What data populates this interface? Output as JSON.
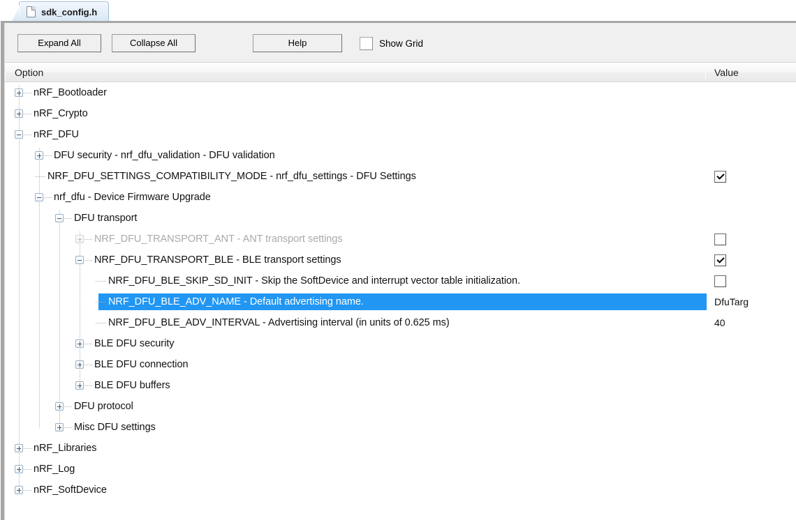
{
  "window": {
    "tab": {
      "label": "sdk_config.h",
      "icon": "document-icon"
    }
  },
  "toolbar": {
    "expand_all": "Expand All",
    "collapse_all": "Collapse All",
    "help": "Help",
    "show_grid_label": "Show Grid",
    "show_grid_checked": false
  },
  "columns": {
    "option": "Option",
    "value": "Value"
  },
  "colors": {
    "selection": "#2196f3",
    "selection_text": "#ffffff",
    "disabled_text": "#aaaaaa",
    "toolbar_bg": "#f0f0f0",
    "frame_border": "#a6a6a6"
  },
  "tree": {
    "rows": [
      {
        "label": "nRF_Bootloader",
        "depth": 0,
        "expander": "plus",
        "value_type": "none",
        "value": "",
        "state": "normal",
        "selected": false
      },
      {
        "label": "nRF_Crypto",
        "depth": 0,
        "expander": "plus",
        "value_type": "none",
        "value": "",
        "state": "normal",
        "selected": false
      },
      {
        "label": "nRF_DFU",
        "depth": 0,
        "expander": "minus",
        "value_type": "none",
        "value": "",
        "state": "normal",
        "selected": false
      },
      {
        "label": "DFU security - nrf_dfu_validation - DFU validation",
        "depth": 1,
        "expander": "plus",
        "value_type": "none",
        "value": "",
        "state": "normal",
        "selected": false
      },
      {
        "label": "NRF_DFU_SETTINGS_COMPATIBILITY_MODE  - nrf_dfu_settings - DFU Settings",
        "depth": 1,
        "expander": "none",
        "value_type": "checkbox",
        "value": "checked",
        "state": "normal",
        "selected": false
      },
      {
        "label": "nrf_dfu - Device Firmware Upgrade",
        "depth": 1,
        "expander": "minus",
        "value_type": "none",
        "value": "",
        "state": "normal",
        "selected": false
      },
      {
        "label": "DFU transport",
        "depth": 2,
        "expander": "minus",
        "value_type": "none",
        "value": "",
        "state": "normal",
        "selected": false
      },
      {
        "label": "NRF_DFU_TRANSPORT_ANT - ANT transport settings",
        "depth": 3,
        "expander": "plus",
        "value_type": "checkbox",
        "value": "unchecked",
        "state": "disabled",
        "selected": false
      },
      {
        "label": "NRF_DFU_TRANSPORT_BLE - BLE transport settings",
        "depth": 3,
        "expander": "minus",
        "value_type": "checkbox",
        "value": "checked",
        "state": "normal",
        "selected": false
      },
      {
        "label": "NRF_DFU_BLE_SKIP_SD_INIT  - Skip the SoftDevice and interrupt vector table initialization.",
        "depth": 4,
        "expander": "none",
        "value_type": "checkbox",
        "value": "unchecked",
        "state": "normal",
        "selected": false
      },
      {
        "label": "NRF_DFU_BLE_ADV_NAME - Default advertising name.",
        "depth": 4,
        "expander": "none",
        "value_type": "text",
        "value": "DfuTarg",
        "state": "normal",
        "selected": true
      },
      {
        "label": "NRF_DFU_BLE_ADV_INTERVAL - Advertising interval (in units of 0.625 ms)",
        "depth": 4,
        "expander": "none",
        "value_type": "text",
        "value": "40",
        "state": "normal",
        "selected": false
      },
      {
        "label": "BLE DFU security",
        "depth": 3,
        "expander": "plus",
        "value_type": "none",
        "value": "",
        "state": "normal",
        "selected": false
      },
      {
        "label": "BLE DFU connection",
        "depth": 3,
        "expander": "plus",
        "value_type": "none",
        "value": "",
        "state": "normal",
        "selected": false
      },
      {
        "label": "BLE DFU buffers",
        "depth": 3,
        "expander": "plus",
        "value_type": "none",
        "value": "",
        "state": "normal",
        "selected": false
      },
      {
        "label": "DFU protocol",
        "depth": 2,
        "expander": "plus",
        "value_type": "none",
        "value": "",
        "state": "normal",
        "selected": false
      },
      {
        "label": "Misc DFU settings",
        "depth": 2,
        "expander": "plus",
        "value_type": "none",
        "value": "",
        "state": "normal",
        "selected": false
      },
      {
        "label": "nRF_Libraries",
        "depth": 0,
        "expander": "plus",
        "value_type": "none",
        "value": "",
        "state": "normal",
        "selected": false
      },
      {
        "label": "nRF_Log",
        "depth": 0,
        "expander": "plus",
        "value_type": "none",
        "value": "",
        "state": "normal",
        "selected": false
      },
      {
        "label": "nRF_SoftDevice",
        "depth": 0,
        "expander": "plus",
        "value_type": "none",
        "value": "",
        "state": "normal",
        "selected": false
      }
    ]
  }
}
